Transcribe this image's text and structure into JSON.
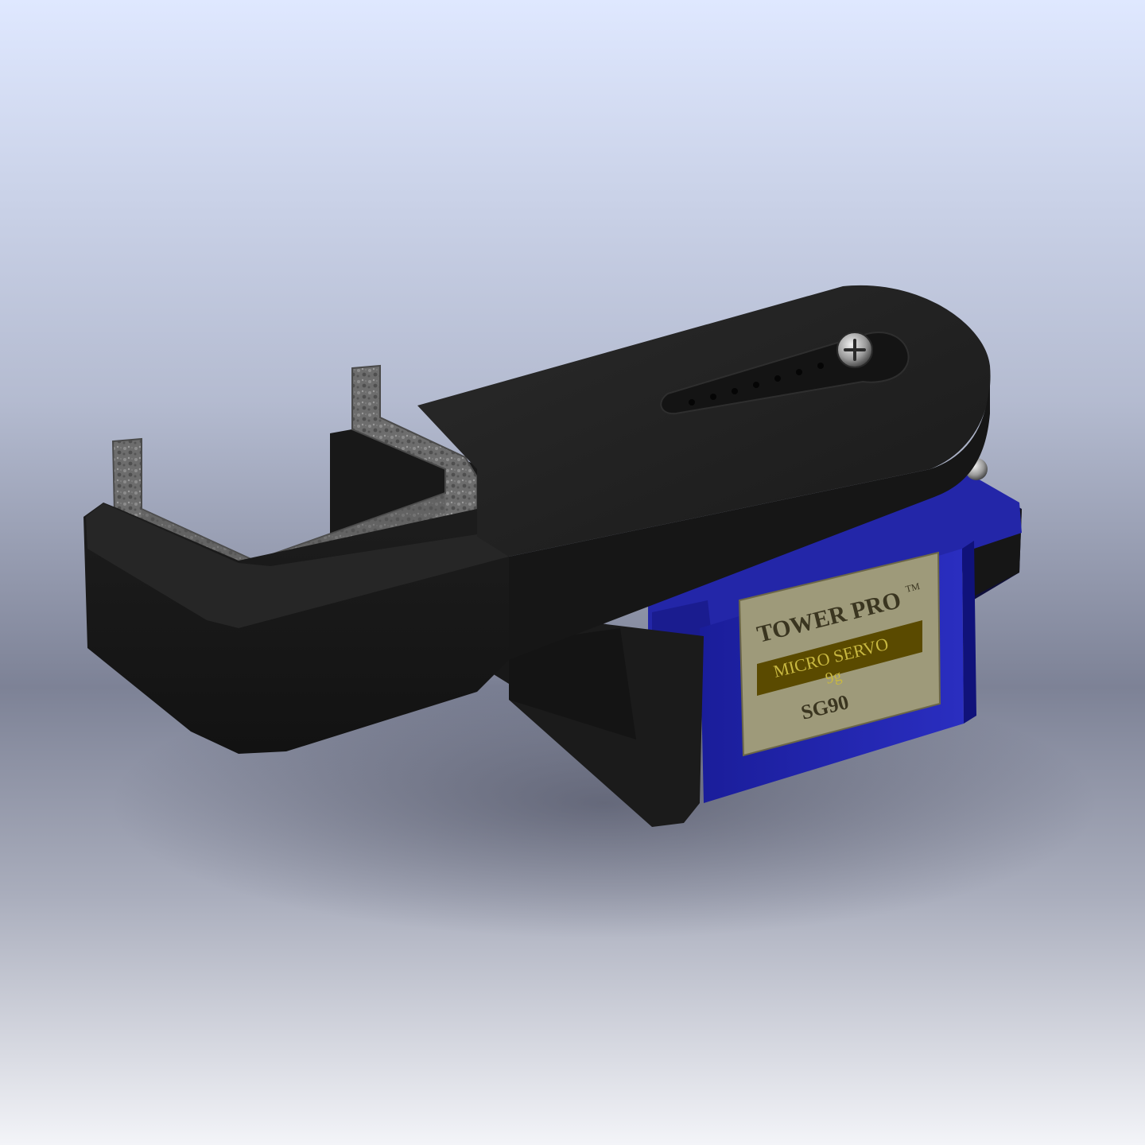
{
  "scene": {
    "background_top": "#dfe8ff",
    "background_mid": "#8f95a8",
    "background_bottom": "#f2f3f7",
    "arm_color": "#202020",
    "servo_color": "#1c1fa0",
    "grip_color": "#6b6b6b"
  },
  "servo_label": {
    "brand_line1": "TOWER PRO",
    "trademark": "TM",
    "line2": "MICRO SERVO",
    "line3": "9g",
    "model": "SG90",
    "plate_color": "#9e9a7a",
    "band_color": "#5a4a00"
  }
}
